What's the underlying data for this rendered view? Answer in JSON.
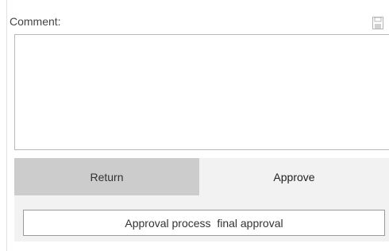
{
  "comment": {
    "label": "Comment:",
    "value": "",
    "icons": {
      "save": "save-icon",
      "expand": "expand-icon"
    }
  },
  "actions": {
    "return_label": "Return",
    "approve_label": "Approve",
    "process_label": "Approval process  final approval"
  },
  "colors": {
    "return_bg": "#cccccc",
    "actions_bg": "#f2f2f2",
    "border": "#b8b8b8"
  }
}
